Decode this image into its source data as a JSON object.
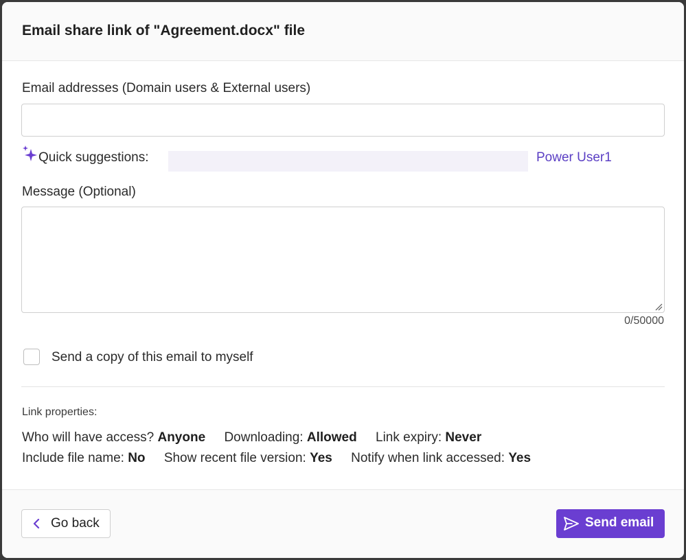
{
  "dialog": {
    "title": "Email share link of \"Agreement.docx\" file"
  },
  "email": {
    "label": "Email addresses (Domain users & External users)",
    "value": "",
    "placeholder": ""
  },
  "suggestions": {
    "label": "Quick suggestions:",
    "link": "Power User1",
    "icon": "sparkle-icon"
  },
  "message": {
    "label": "Message (Optional)",
    "value": "",
    "counter": "0/50000"
  },
  "copy_to_self": {
    "label": "Send a copy of this email to myself",
    "checked": false
  },
  "link_properties": {
    "heading": "Link properties:",
    "row1": [
      {
        "label": "Who will have access?",
        "value": "Anyone"
      },
      {
        "label": "Downloading:",
        "value": "Allowed"
      },
      {
        "label": "Link expiry:",
        "value": "Never"
      }
    ],
    "row2": [
      {
        "label": "Include file name:",
        "value": "No"
      },
      {
        "label": "Show recent file version:",
        "value": "Yes"
      },
      {
        "label": "Notify when link accessed:",
        "value": "Yes"
      }
    ]
  },
  "footer": {
    "back_label": "Go back",
    "send_label": "Send email",
    "accent_color": "#6a3ed1"
  }
}
